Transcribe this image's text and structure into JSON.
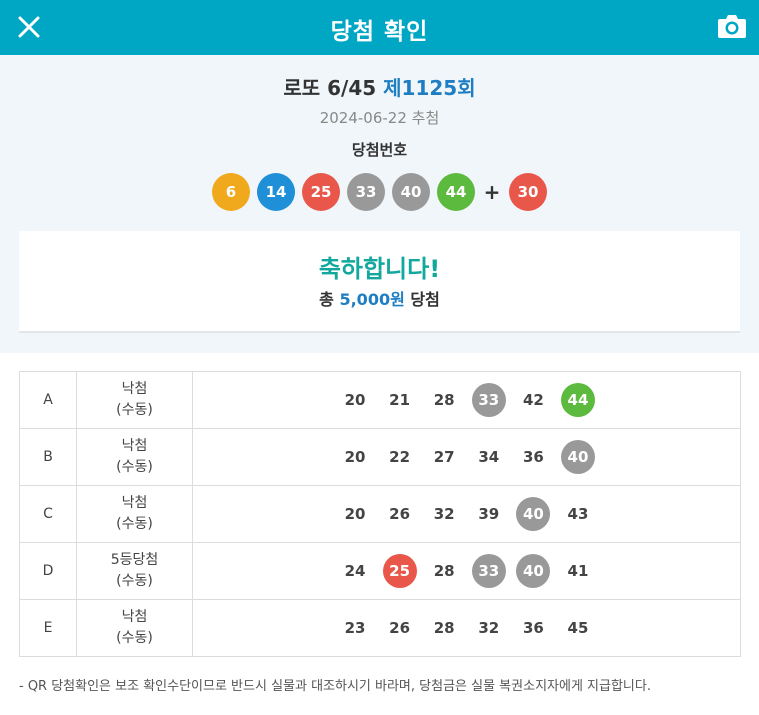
{
  "header": {
    "title": "당첨 확인",
    "colors": {
      "bar": "#00a7c4"
    },
    "left_icon": "close-icon",
    "right_icon": "camera-icon"
  },
  "draw": {
    "game": "로또 6/45",
    "round": "제1125회",
    "date": "2024-06-22 추첨",
    "numbers_label": "당첨번호",
    "winning_numbers": [
      6,
      14,
      25,
      33,
      40,
      44
    ],
    "bonus_number": 30,
    "plus": "+"
  },
  "result": {
    "congrats": "축하합니다!",
    "prize_prefix": "총",
    "prize_amount": "5,000원",
    "prize_suffix": "당첨"
  },
  "tickets": [
    {
      "letter": "A",
      "result": "낙첨",
      "mode": "(수동)",
      "numbers": [
        20,
        21,
        28,
        33,
        42,
        44
      ]
    },
    {
      "letter": "B",
      "result": "낙첨",
      "mode": "(수동)",
      "numbers": [
        20,
        22,
        27,
        34,
        36,
        40
      ]
    },
    {
      "letter": "C",
      "result": "낙첨",
      "mode": "(수동)",
      "numbers": [
        20,
        26,
        32,
        39,
        40,
        43
      ]
    },
    {
      "letter": "D",
      "result": "5등당첨",
      "mode": "(수동)",
      "numbers": [
        24,
        25,
        28,
        33,
        40,
        41
      ]
    },
    {
      "letter": "E",
      "result": "낙첨",
      "mode": "(수동)",
      "numbers": [
        23,
        26,
        28,
        32,
        36,
        45
      ]
    }
  ],
  "ball_colors": {
    "1-10": "#f0a91c",
    "11-20": "#1f8fd8",
    "21-30": "#e8574a",
    "31-40": "#999999",
    "41-45": "#5cba3e"
  },
  "note": "- QR 당첨확인은 보조 확인수단이므로 반드시 실물과 대조하시기 바라며, 당첨금은 실물 복권소지자에게 지급합니다."
}
